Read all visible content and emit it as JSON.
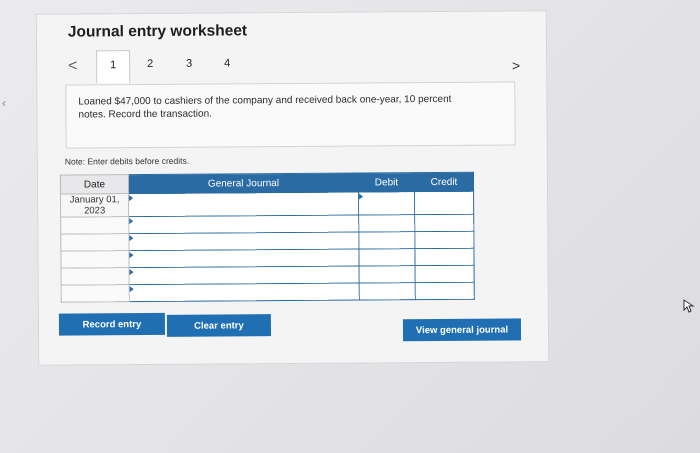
{
  "worksheet": {
    "title": "Journal entry worksheet",
    "tabs": [
      {
        "label": "1",
        "active": true
      },
      {
        "label": "2",
        "active": false
      },
      {
        "label": "3",
        "active": false
      },
      {
        "label": "4",
        "active": false
      }
    ],
    "prev_icon": "chevron-left-icon",
    "next_icon": "chevron-right-icon",
    "prompt": "Loaned $47,000 to cashiers of the company and received back one-year, 10 percent notes. Record the transaction.",
    "note": "Note: Enter debits before credits."
  },
  "journal": {
    "headers": {
      "date": "Date",
      "account": "General Journal",
      "debit": "Debit",
      "credit": "Credit"
    },
    "rows": [
      {
        "date": "January 01, 2023",
        "account": "",
        "debit": "",
        "credit": ""
      },
      {
        "date": "",
        "account": "",
        "debit": "",
        "credit": ""
      },
      {
        "date": "",
        "account": "",
        "debit": "",
        "credit": ""
      },
      {
        "date": "",
        "account": "",
        "debit": "",
        "credit": ""
      },
      {
        "date": "",
        "account": "",
        "debit": "",
        "credit": ""
      },
      {
        "date": "",
        "account": "",
        "debit": "",
        "credit": ""
      }
    ]
  },
  "buttons": {
    "record": "Record entry",
    "clear": "Clear entry",
    "view": "View general journal"
  },
  "colors": {
    "accent": "#1f6fb2",
    "header": "#2b6ba3"
  }
}
